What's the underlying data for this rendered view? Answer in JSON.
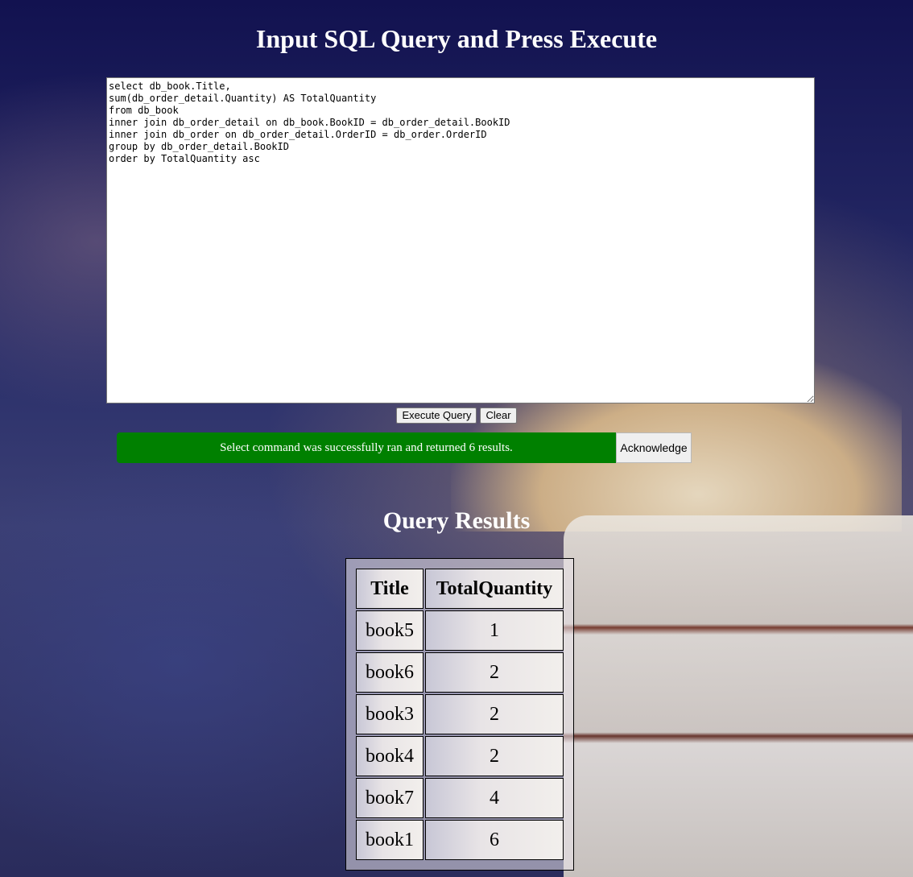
{
  "header": {
    "title": "Input SQL Query and Press Execute"
  },
  "query": {
    "text": "select db_book.Title,\nsum(db_order_detail.Quantity) AS TotalQuantity\nfrom db_book\ninner join db_order_detail on db_book.BookID = db_order_detail.BookID\ninner join db_order on db_order_detail.OrderID = db_order.OrderID\ngroup by db_order_detail.BookID\norder by TotalQuantity asc"
  },
  "buttons": {
    "execute": "Execute Query",
    "clear": "Clear"
  },
  "status": {
    "message": "Select command was successfully ran and returned 6 results.",
    "acknowledge": "Acknowledge",
    "color": "#008000"
  },
  "results": {
    "title": "Query Results",
    "columns": [
      "Title",
      "TotalQuantity"
    ],
    "rows": [
      [
        "book5",
        "1"
      ],
      [
        "book6",
        "2"
      ],
      [
        "book3",
        "2"
      ],
      [
        "book4",
        "2"
      ],
      [
        "book7",
        "4"
      ],
      [
        "book1",
        "6"
      ]
    ]
  }
}
